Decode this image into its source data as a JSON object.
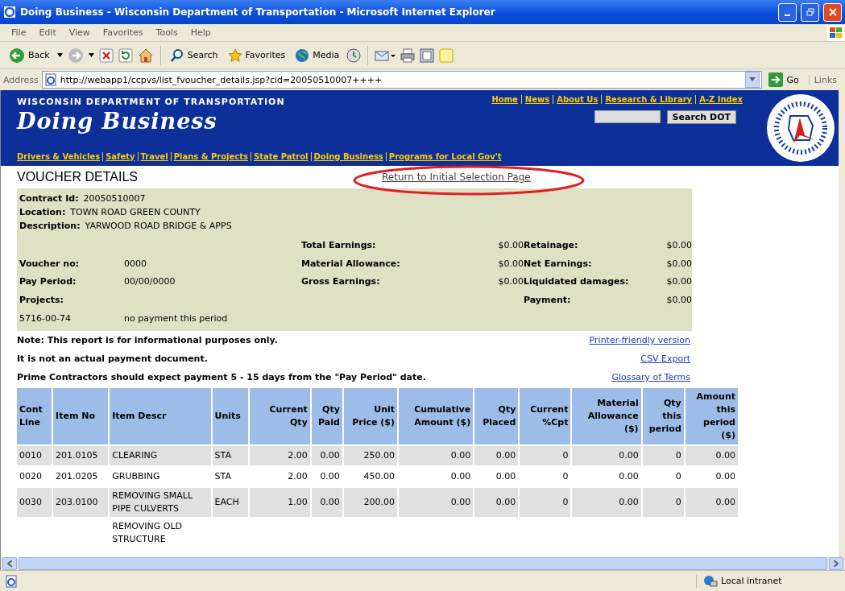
{
  "window": {
    "title": "Doing Business - Wisconsin Department of Transportation - Microsoft Internet Explorer"
  },
  "menu": [
    "File",
    "Edit",
    "View",
    "Favorites",
    "Tools",
    "Help"
  ],
  "toolbar": [
    {
      "kind": "back",
      "label": "Back"
    },
    {
      "kind": "forward"
    },
    {
      "kind": "stop"
    },
    {
      "kind": "refresh"
    },
    {
      "kind": "home"
    },
    {
      "kind": "search",
      "label": "Search"
    },
    {
      "kind": "favorites",
      "label": "Favorites"
    },
    {
      "kind": "media",
      "label": "Media"
    },
    {
      "kind": "history"
    },
    {
      "kind": "mail"
    },
    {
      "kind": "print"
    },
    {
      "kind": "edit"
    },
    {
      "kind": "note"
    }
  ],
  "address": {
    "label": "Address",
    "url": "http://webapp1/ccpvs/list_fvoucher_details.jsp?cid=20050510007++++",
    "go": "Go",
    "links": "Links"
  },
  "header": {
    "agency": "WISCONSIN DEPARTMENT OF TRANSPORTATION",
    "site_title": "Doing Business",
    "top_links": [
      "Home",
      "News",
      "About Us",
      "Research & Library",
      "A-Z Index"
    ],
    "search_button": "Search DOT",
    "nav_links": [
      "Drivers & Vehicles",
      "Safety",
      "Travel",
      "Plans & Projects",
      "State Patrol",
      "Doing Business",
      "Programs for Local Gov't"
    ]
  },
  "page": {
    "heading": "VOUCHER DETAILS",
    "return_link": "Return to Initial Selection Page",
    "contract": [
      {
        "label": "Contract Id:",
        "value": "20050510007"
      },
      {
        "label": "Location:",
        "value": "TOWN ROAD GREEN COUNTY"
      },
      {
        "label": "Description:",
        "value": "YARWOOD ROAD BRIDGE & APPS"
      }
    ],
    "summary_rows": [
      [
        null,
        null,
        {
          "kind": "label",
          "text": "Total Earnings:"
        },
        {
          "kind": "amount",
          "text": "$0.00"
        },
        {
          "kind": "label",
          "text": "Retainage:"
        },
        {
          "kind": "amount",
          "text": "$0.00"
        }
      ],
      [
        {
          "kind": "label",
          "text": "Voucher no:"
        },
        {
          "kind": "value",
          "text": "0000"
        },
        {
          "kind": "label",
          "text": "Material Allowance:"
        },
        {
          "kind": "amount",
          "text": "$0.00"
        },
        {
          "kind": "label",
          "text": "Net Earnings:"
        },
        {
          "kind": "amount",
          "text": "$0.00"
        }
      ],
      [
        {
          "kind": "label",
          "text": "Pay Period:"
        },
        {
          "kind": "value",
          "text": "00/00/0000"
        },
        {
          "kind": "label",
          "text": "Gross Earnings:"
        },
        {
          "kind": "amount",
          "text": "$0.00"
        },
        {
          "kind": "label",
          "text": "Liquidated damages:"
        },
        {
          "kind": "amount",
          "text": "$0.00"
        }
      ],
      [
        {
          "kind": "label",
          "text": "Projects:"
        },
        null,
        null,
        null,
        {
          "kind": "label",
          "text": "Payment:"
        },
        {
          "kind": "amount",
          "text": "$0.00"
        }
      ],
      [
        {
          "kind": "value",
          "text": "5716-00-74"
        },
        {
          "kind": "value",
          "text": "no payment this period"
        },
        null,
        null,
        null,
        null
      ]
    ],
    "notes": [
      {
        "text": "Note: This report is for informational purposes only.",
        "link": "Printer-friendly version"
      },
      {
        "text": "It is not an actual payment document.",
        "link": "CSV Export"
      },
      {
        "text": "Prime Contractors should expect payment 5 - 15 days from the \"Pay Period\" date.",
        "link": "Glossary of Terms"
      }
    ]
  },
  "table": {
    "columns": [
      "Cont Line",
      "Item No",
      "Item Descr",
      "Units",
      "Current Qty",
      "Qty Paid",
      "Unit Price ($)",
      "Cumulative Amount ($)",
      "Qty Placed",
      "Current %Cpt",
      "Material Allowance ($)",
      "Qty this period",
      "Amount this period ($)"
    ],
    "rows": [
      [
        "0010",
        "201.0105",
        "CLEARING",
        "STA",
        "2.00",
        "0.00",
        "250.00",
        "0.00",
        "0.00",
        "0",
        "0.00",
        "0",
        "0.00"
      ],
      [
        "0020",
        "201.0205",
        "GRUBBING",
        "STA",
        "2.00",
        "0.00",
        "450.00",
        "0.00",
        "0.00",
        "0",
        "0.00",
        "0",
        "0.00"
      ],
      [
        "0030",
        "203.0100",
        "REMOVING SMALL PIPE CULVERTS",
        "EACH",
        "1.00",
        "0.00",
        "200.00",
        "0.00",
        "0.00",
        "0",
        "0.00",
        "0",
        "0.00"
      ],
      [
        null,
        null,
        "REMOVING OLD STRUCTURE",
        null,
        null,
        null,
        null,
        null,
        null,
        null,
        null,
        null,
        null
      ]
    ]
  },
  "status_bar": {
    "zone": "Local intranet"
  }
}
